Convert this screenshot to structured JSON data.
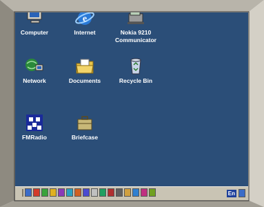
{
  "desktop": {
    "icons": [
      {
        "label": "Computer",
        "icon": "computer-icon"
      },
      {
        "label": "Internet",
        "icon": "internet-globe-icon"
      },
      {
        "label": "Nokia 9210",
        "label2": "Communicator",
        "icon": "nokia-communicator-icon"
      },
      {
        "label": "Network",
        "icon": "network-icon"
      },
      {
        "label": "Documents",
        "icon": "documents-folder-icon"
      },
      {
        "label": "Recycle Bin",
        "icon": "recycle-bin-icon"
      },
      {
        "label": "FMRadio",
        "icon": "fmradio-icon"
      },
      {
        "label": "Briefcase",
        "icon": "briefcase-icon"
      }
    ],
    "background_color": "#2b4e78"
  },
  "taskbar": {
    "tray_label": "En",
    "quick_launch_colors": [
      "#3a6cc8",
      "#d23a2a",
      "#3aa33a",
      "#e0b020",
      "#8a3ab8",
      "#2aa0c0",
      "#d06020",
      "#4a4ad0",
      "#c0c0c0",
      "#20a060",
      "#b03030",
      "#606060",
      "#d0a040",
      "#3080d0",
      "#c03080",
      "#70a020"
    ]
  }
}
